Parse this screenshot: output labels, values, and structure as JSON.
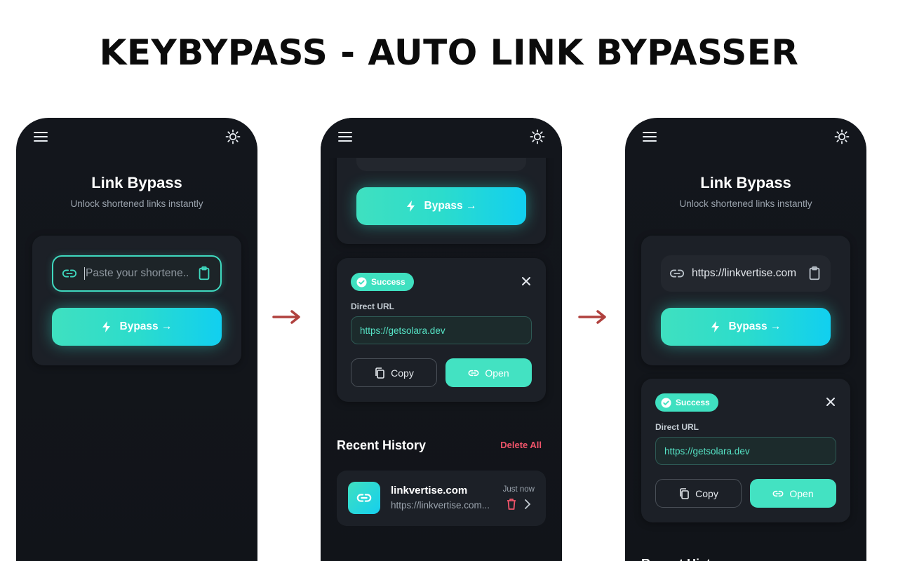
{
  "headline": "KEYBYPASS - AUTO LINK BYPASSER",
  "app": {
    "title": "Link Bypass",
    "subtitle": "Unlock shortened links instantly",
    "placeholder": "Paste your shortene...",
    "filled_url": "https://linkvertise.com",
    "bypass_label": "Bypass →",
    "icons": {
      "menu": "menu-icon",
      "theme": "sun-icon",
      "link": "link-icon",
      "paste": "clipboard-icon",
      "bolt": "bolt-icon",
      "close": "close-icon",
      "copy": "copy-icon",
      "open": "link-icon",
      "trash": "trash-icon",
      "chevron": "chevron-right-icon"
    }
  },
  "result": {
    "status": "Success",
    "label": "Direct URL",
    "url": "https://getsolara.dev",
    "copy_label": "Copy",
    "open_label": "Open"
  },
  "history": {
    "title": "Recent History",
    "delete_all": "Delete All",
    "items": [
      {
        "name": "linkvertise.com",
        "url": "https://linkvertise.com...",
        "time": "Just now"
      }
    ]
  },
  "colors": {
    "accent": "#3fe0c0",
    "accent_end": "#11cff0",
    "danger": "#f0546a",
    "phone_bg": "#13161c",
    "card_bg": "#1c2027",
    "arrow": "#b0413e"
  }
}
